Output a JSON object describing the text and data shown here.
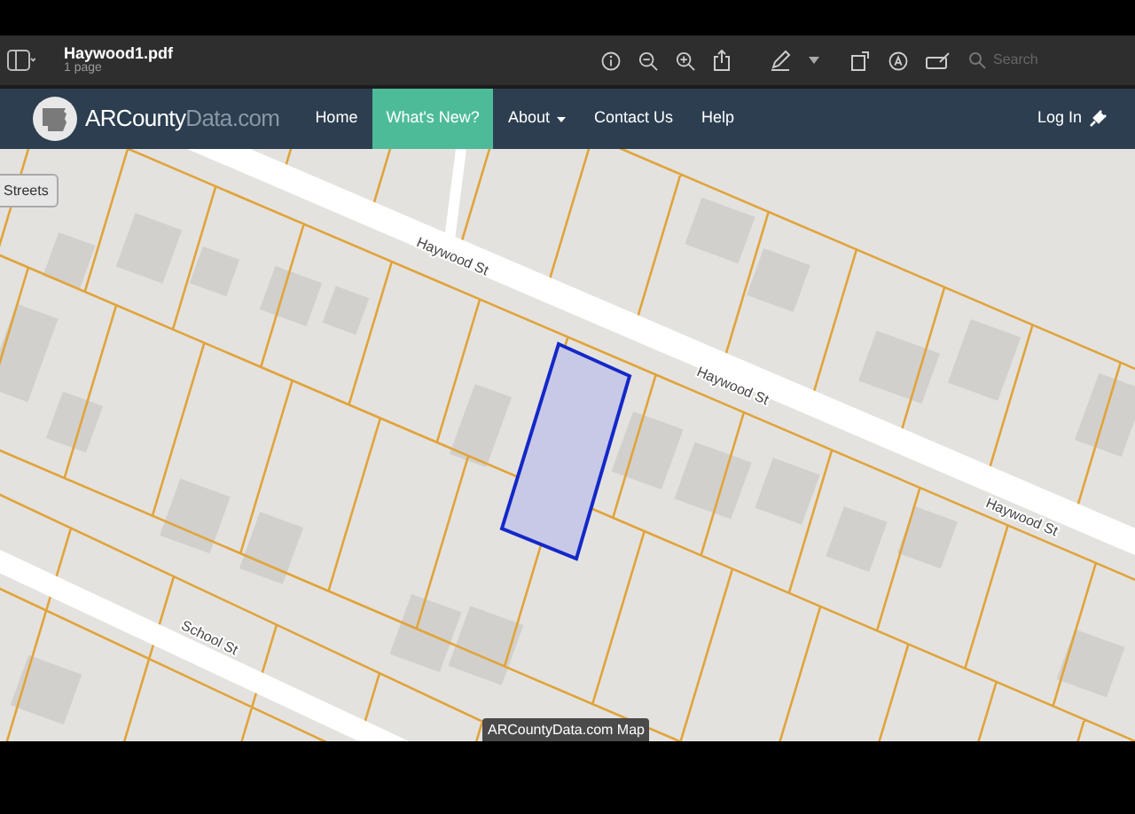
{
  "pdf_viewer": {
    "file_name": "Haywood1.pdf",
    "page_count": "1 page",
    "search": {
      "placeholder": "Search"
    }
  },
  "navbar": {
    "logo": {
      "brand": "ARCounty",
      "suffix": "Data.com"
    },
    "items": [
      {
        "label": "Home",
        "selected": false,
        "dropdown": false
      },
      {
        "label": "What's New?",
        "selected": true,
        "dropdown": false
      },
      {
        "label": "About",
        "selected": false,
        "dropdown": true
      },
      {
        "label": "Contact Us",
        "selected": false,
        "dropdown": false
      },
      {
        "label": "Help",
        "selected": false,
        "dropdown": false
      }
    ],
    "login": "Log In"
  },
  "map": {
    "layer_button": "Streets",
    "street_labels": [
      "Haywood St",
      "Haywood St",
      "Haywood St",
      "School St"
    ],
    "attribution": "ARCountyData.com Map"
  }
}
